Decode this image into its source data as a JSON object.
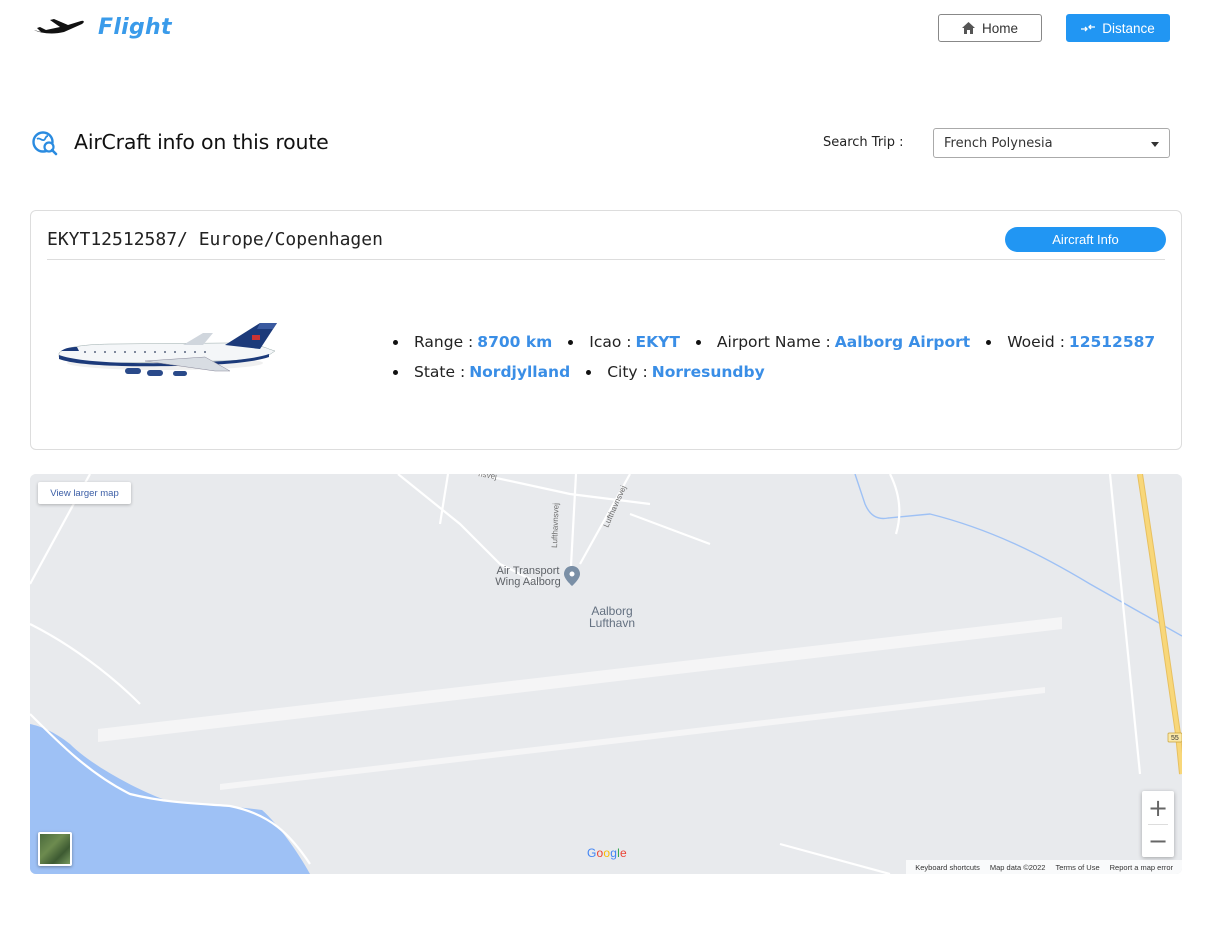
{
  "brand": {
    "name": "Flight"
  },
  "nav": {
    "home": "Home",
    "distance": "Distance"
  },
  "section": {
    "title": "AirCraft info on this route"
  },
  "search": {
    "label": "Search Trip :",
    "selected": "French Polynesia"
  },
  "card": {
    "title": "EKYT12512587/ Europe/Copenhagen",
    "button": "Aircraft Info",
    "info": [
      {
        "label": "Range :",
        "value": "8700 km"
      },
      {
        "label": "Icao :",
        "value": "EKYT"
      },
      {
        "label": "Airport Name :",
        "value": "Aalborg Airport"
      },
      {
        "label": "Woeid :",
        "value": "12512587"
      },
      {
        "label": "State :",
        "value": "Nordjylland"
      },
      {
        "label": "City :",
        "value": "Norresundby"
      }
    ]
  },
  "map": {
    "view_larger": "View larger map",
    "poi": "Air Transport Wing Aalborg",
    "area": "Aalborg Lufthavn",
    "road_1": "Lufthavnsvej",
    "road_2": "Lufthavnsvej",
    "road_3": "hsvej",
    "road_shield": "55",
    "zoom_in": "+",
    "zoom_out": "−",
    "logo": "Google",
    "footer": {
      "shortcuts": "Keyboard shortcuts",
      "data": "Map data ©2022",
      "terms": "Terms of Use",
      "report": "Report a map error"
    }
  },
  "colors": {
    "accent": "#2196f3",
    "value": "#3a8ee6",
    "water": "#9ec1f5",
    "road_major": "#f8d77a"
  }
}
